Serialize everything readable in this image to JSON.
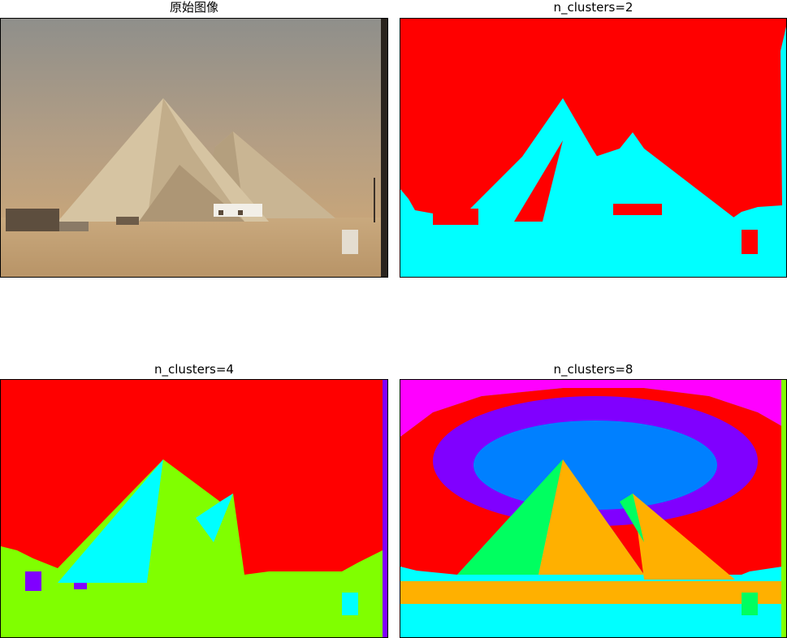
{
  "figure": {
    "panels": [
      {
        "title": "原始图像",
        "kind": "original"
      },
      {
        "title": "n_clusters=2",
        "kind": "clusters",
        "n_clusters": 2,
        "palette": [
          "#ff0000",
          "#00ffff"
        ]
      },
      {
        "title": "n_clusters=4",
        "kind": "clusters",
        "n_clusters": 4,
        "palette": [
          "#ff0000",
          "#80ff00",
          "#00ffff",
          "#8000ff"
        ]
      },
      {
        "title": "n_clusters=8",
        "kind": "clusters",
        "n_clusters": 8,
        "palette": [
          "#ff0000",
          "#ff00ff",
          "#8000ff",
          "#0080ff",
          "#00ffff",
          "#00ff60",
          "#80ff00",
          "#ffb000"
        ]
      }
    ],
    "original_colors": {
      "sky_top": "#8f8f8b",
      "sky_bottom": "#c7a57a",
      "pyramid_light": "#d4c1a0",
      "pyramid_shade": "#b8a281",
      "ground": "#c6a57a",
      "frame_dark": "#2a241e"
    }
  }
}
